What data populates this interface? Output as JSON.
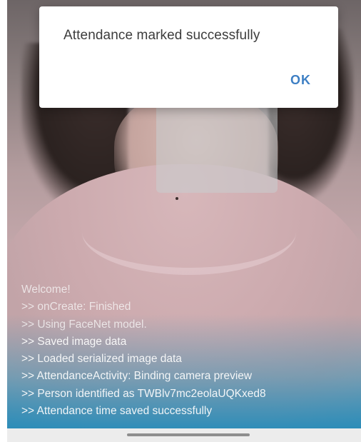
{
  "dialog": {
    "message": "Attendance marked successfully",
    "ok_label": "OK"
  },
  "log": {
    "lines": [
      "Welcome!",
      ">> onCreate: Finished",
      ">> Using FaceNet model.",
      ">> Saved image data",
      ">> Loaded serialized image data",
      ">> AttendanceActivity: Binding camera preview",
      ">> Person identified as TWBlv7mc2eolaUQKxed8",
      ">> Attendance time saved successfully"
    ]
  },
  "colors": {
    "dialog_button": "#3d7fc4",
    "bottom_tint": "#3f93b6"
  }
}
